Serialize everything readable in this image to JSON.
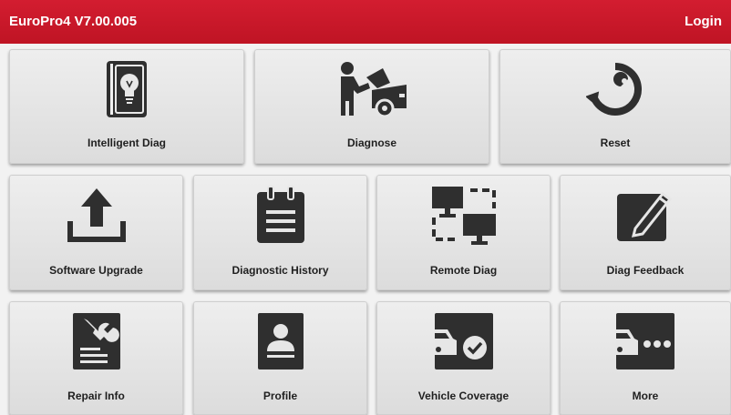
{
  "header": {
    "title": "EuroPro4 V7.00.005",
    "login_label": "Login",
    "background_color": "#c8192b"
  },
  "tiles": [
    {
      "label": "Intelligent Diag",
      "icon": "lightbulb-book-icon"
    },
    {
      "label": "Diagnose",
      "icon": "mechanic-car-icon"
    },
    {
      "label": "Reset",
      "icon": "wrench-reset-icon"
    },
    {
      "label": "Software Upgrade",
      "icon": "upload-icon"
    },
    {
      "label": "Diagnostic History",
      "icon": "clipboard-icon"
    },
    {
      "label": "Remote Diag",
      "icon": "remote-monitors-icon"
    },
    {
      "label": "Diag Feedback",
      "icon": "pencil-edit-icon"
    },
    {
      "label": "Repair Info",
      "icon": "repair-document-icon"
    },
    {
      "label": "Profile",
      "icon": "profile-card-icon"
    },
    {
      "label": "Vehicle Coverage",
      "icon": "vehicle-check-icon"
    },
    {
      "label": "More",
      "icon": "vehicle-more-icon"
    }
  ],
  "icon_color": "#2f2f2f"
}
